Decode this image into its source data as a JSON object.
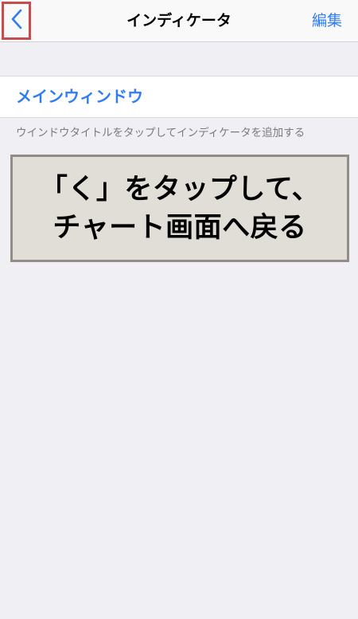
{
  "navbar": {
    "back_icon": "chevron-left-icon",
    "title": "インディケータ",
    "edit_label": "編集",
    "accent_color": "#2f7cf6",
    "highlight_color": "#c84b4f"
  },
  "section": {
    "row_label": "メインウィンドウ",
    "footer_text": "ウインドウタイトルをタップしてインディケータを追加する"
  },
  "callout": {
    "line1": "「く」をタップして、",
    "line2": "チャート画面へ戻る"
  }
}
